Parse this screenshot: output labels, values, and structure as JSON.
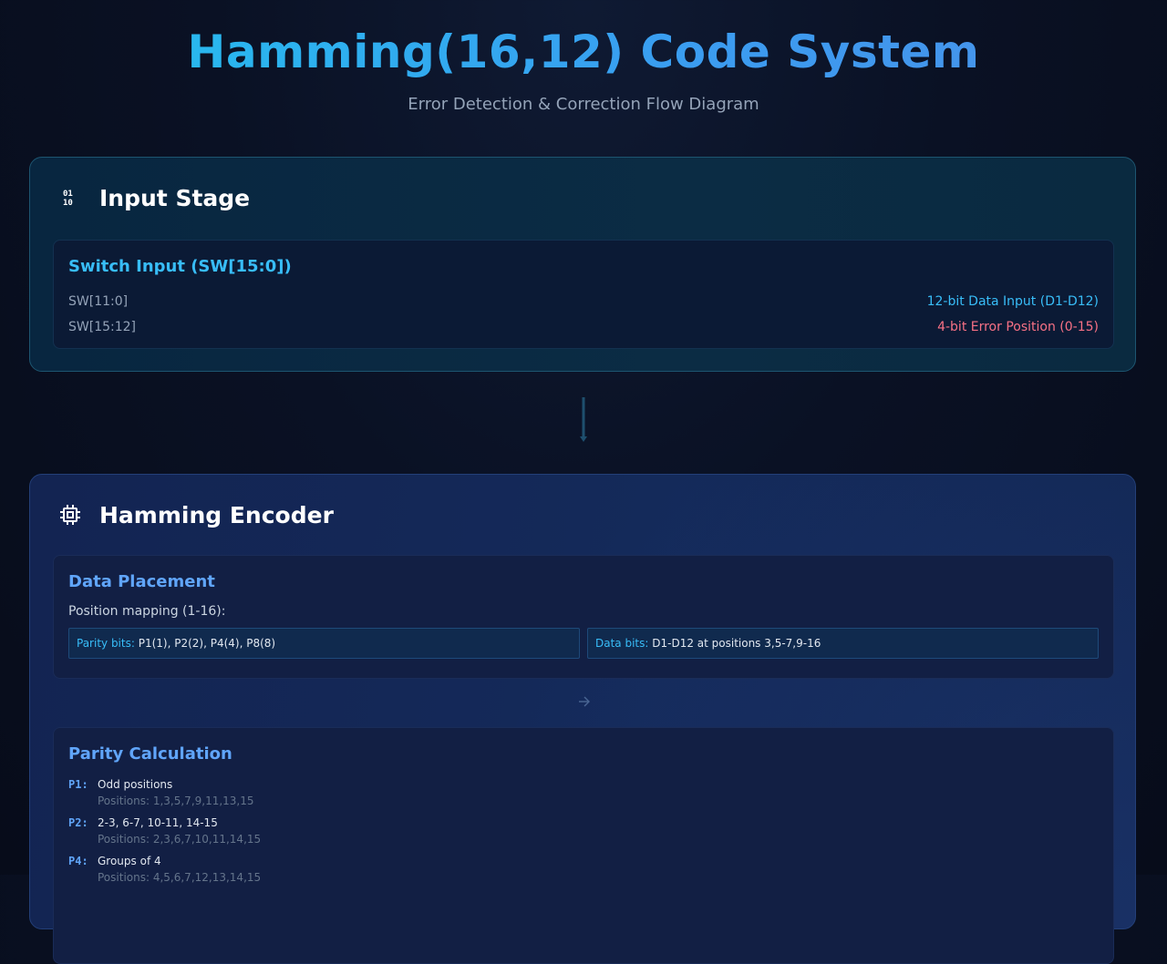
{
  "header": {
    "title": "Hamming(16,12) Code System",
    "subtitle": "Error Detection & Correction Flow Diagram"
  },
  "input_stage": {
    "title": "Input Stage",
    "icon": "binary-icon",
    "card": {
      "title": "Switch Input (SW[15:0])",
      "rows": [
        {
          "key": "SW[11:0]",
          "value": "12-bit Data Input (D1-D12)",
          "color": "#38bdf8"
        },
        {
          "key": "SW[15:12]",
          "value": "4-bit Error Position (0-15)",
          "color": "#f87185"
        }
      ]
    }
  },
  "encoder_stage": {
    "title": "Hamming Encoder",
    "icon": "chip-icon",
    "placement": {
      "title": "Data Placement",
      "mapping_label": "Position mapping (1-16):",
      "parity_box": {
        "label": "Parity bits:",
        "value": "P1(1), P2(2), P4(4), P8(8)"
      },
      "data_box": {
        "label": "Data bits:",
        "value": "D1-D12 at positions 3,5-7,9-16"
      }
    },
    "parity": {
      "title": "Parity Calculation",
      "items": [
        {
          "key": "P1:",
          "desc": "Odd positions",
          "positions": "Positions: 1,3,5,7,9,11,13,15"
        },
        {
          "key": "P2:",
          "desc": "2-3, 6-7, 10-11, 14-15",
          "positions": "Positions: 2,3,6,7,10,11,14,15"
        },
        {
          "key": "P4:",
          "desc": "Groups of 4",
          "positions": "Positions: 4,5,6,7,12,13,14,15"
        }
      ]
    }
  },
  "colors": {
    "accent": "#38bdf8",
    "error": "#f87185",
    "encoder_accent": "#60a5fa"
  }
}
